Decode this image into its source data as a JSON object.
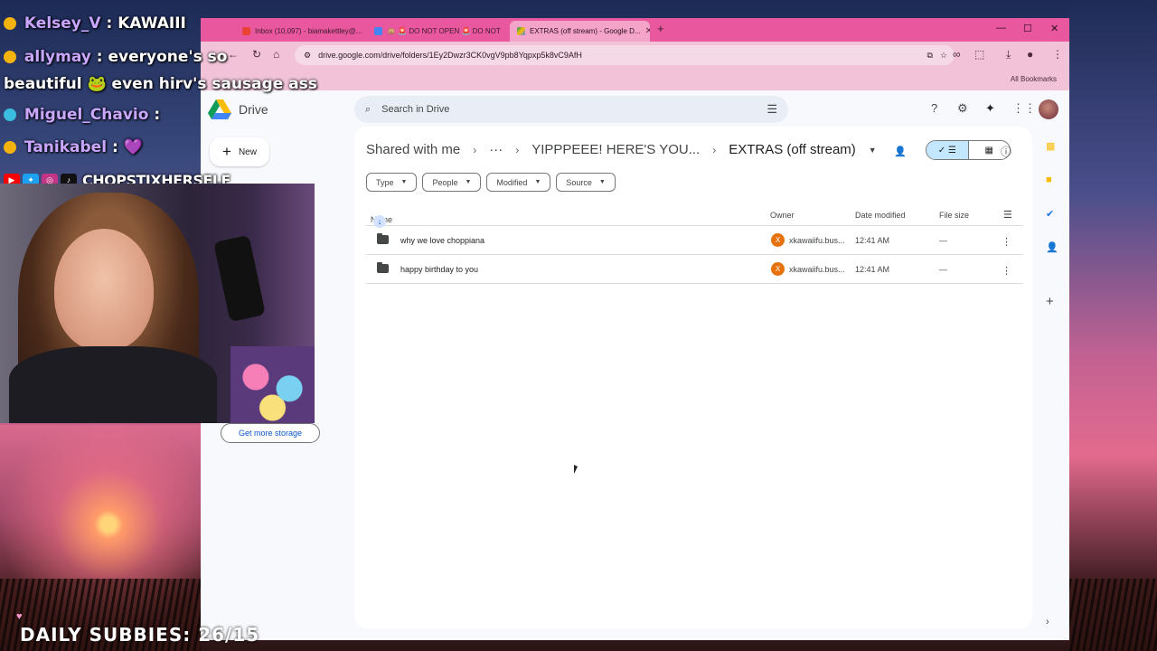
{
  "colors": {
    "tabstrip": "#e9579f",
    "toolbar": "#f1c2d8",
    "drive_blue": "#0b57d0",
    "owner_avatar": "#e8710a"
  },
  "browser": {
    "tabs": [
      {
        "title": "Inbox (10,097) - biamakettley@...",
        "icon": "gmail-icon"
      },
      {
        "title": "🙊 🚨 DO NOT OPEN 🚨 DO NOT",
        "icon": "docs-icon"
      },
      {
        "title": "EXTRAS (off stream) - Google D...",
        "icon": "drive-icon"
      }
    ],
    "url": "drive.google.com/drive/folders/1Ey2Dwzr3CK0vgV9pb8Yqpxp5k8vC9AfH",
    "bookmarks_label": "All Bookmarks"
  },
  "drive": {
    "app_name": "Drive",
    "new_label": "New",
    "storage_button": "Get more storage",
    "search_placeholder": "Search in Drive",
    "breadcrumb": {
      "root": "Shared with me",
      "ellipsis": "···",
      "parent": "YIPPPEEE! HERE'S YOU...",
      "current": "EXTRAS (off stream)"
    },
    "filters": [
      "Type",
      "People",
      "Modified",
      "Source"
    ],
    "columns": {
      "name": "Name",
      "owner": "Owner",
      "modified": "Date modified",
      "size": "File size"
    },
    "files": [
      {
        "name": "why we love choppiana",
        "owner_initial": "X",
        "owner": "xkawaiifu.bus...",
        "modified": "12:41 AM",
        "size": "—"
      },
      {
        "name": "happy birthday to you",
        "owner_initial": "X",
        "owner": "xkawaiifu.bus...",
        "modified": "12:41 AM",
        "size": "—"
      }
    ]
  },
  "overlay": {
    "chat": [
      {
        "user": "Kelsey_V",
        "message": "KAWAIII"
      },
      {
        "user": "allymay",
        "message": "everyone's so"
      },
      {
        "user": "",
        "message": "beautiful 🐸 even hirv's sausage ass"
      },
      {
        "user": "Miguel_Chavio",
        "message": ""
      },
      {
        "user": "Tanikabel",
        "message": "💜"
      }
    ],
    "handle": "CHOPSTIXHERSELF",
    "daily_subs": "DAILY SUBBIES: 26/15"
  }
}
